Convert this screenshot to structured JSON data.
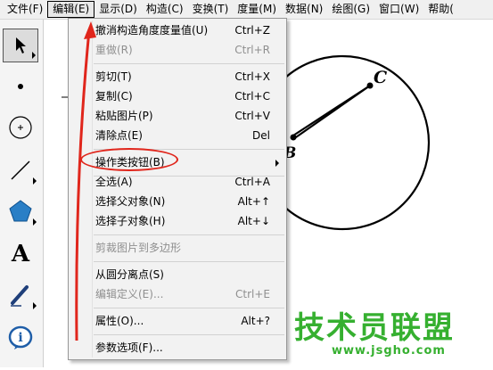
{
  "menubar": {
    "items": [
      {
        "label": "文件(F)"
      },
      {
        "label": "编辑(E)"
      },
      {
        "label": "显示(D)"
      },
      {
        "label": "构造(C)"
      },
      {
        "label": "变换(T)"
      },
      {
        "label": "度量(M)"
      },
      {
        "label": "数据(N)"
      },
      {
        "label": "绘图(G)"
      },
      {
        "label": "窗口(W)"
      },
      {
        "label": "帮助("
      }
    ],
    "active_index": 1
  },
  "toolbar": {
    "tools": [
      {
        "name": "arrow-select-icon",
        "selected": true
      },
      {
        "name": "point-tool-icon"
      },
      {
        "name": "compass-tool-icon"
      },
      {
        "name": "line-tool-icon"
      },
      {
        "name": "polygon-tool-icon"
      },
      {
        "name": "text-tool-icon",
        "glyph": "A"
      },
      {
        "name": "marker-tool-icon"
      },
      {
        "name": "info-tool-icon",
        "glyph": "i"
      }
    ]
  },
  "canvas": {
    "point_labels": {
      "c": "C",
      "b": "B"
    }
  },
  "edit_menu": {
    "items": [
      {
        "label": "撤消构造角度度量值(U)",
        "shortcut": "Ctrl+Z",
        "enabled": true
      },
      {
        "label": "重做(R)",
        "shortcut": "Ctrl+R",
        "enabled": false
      },
      {
        "label": "剪切(T)",
        "shortcut": "Ctrl+X",
        "enabled": true
      },
      {
        "label": "复制(C)",
        "shortcut": "Ctrl+C",
        "enabled": true
      },
      {
        "label": "粘贴图片(P)",
        "shortcut": "Ctrl+V",
        "enabled": true
      },
      {
        "label": "清除点(E)",
        "shortcut": "Del",
        "enabled": true
      },
      {
        "label": "操作类按钮(B)",
        "shortcut": "",
        "enabled": true,
        "submenu": true
      },
      {
        "label": "全选(A)",
        "shortcut": "Ctrl+A",
        "enabled": true
      },
      {
        "label": "选择父对象(N)",
        "shortcut": "Alt+↑",
        "enabled": true
      },
      {
        "label": "选择子对象(H)",
        "shortcut": "Alt+↓",
        "enabled": true
      },
      {
        "label": "剪裁图片到多边形",
        "shortcut": "",
        "enabled": false
      },
      {
        "label": "从圆分离点(S)",
        "shortcut": "",
        "enabled": true
      },
      {
        "label": "编辑定义(E)...",
        "shortcut": "Ctrl+E",
        "enabled": false
      },
      {
        "label": "属性(O)...",
        "shortcut": "Alt+?",
        "enabled": true
      },
      {
        "label": "参数选项(F)...",
        "shortcut": "",
        "enabled": true
      }
    ],
    "highlighted_item": "操作类按钮(B)"
  },
  "watermark": {
    "title": "技术员联盟",
    "url": "www.jsgho.com"
  },
  "colors": {
    "annotation": "#e0261c",
    "watermark": "#36b030",
    "polygon_tool": "#2a7fc6"
  }
}
